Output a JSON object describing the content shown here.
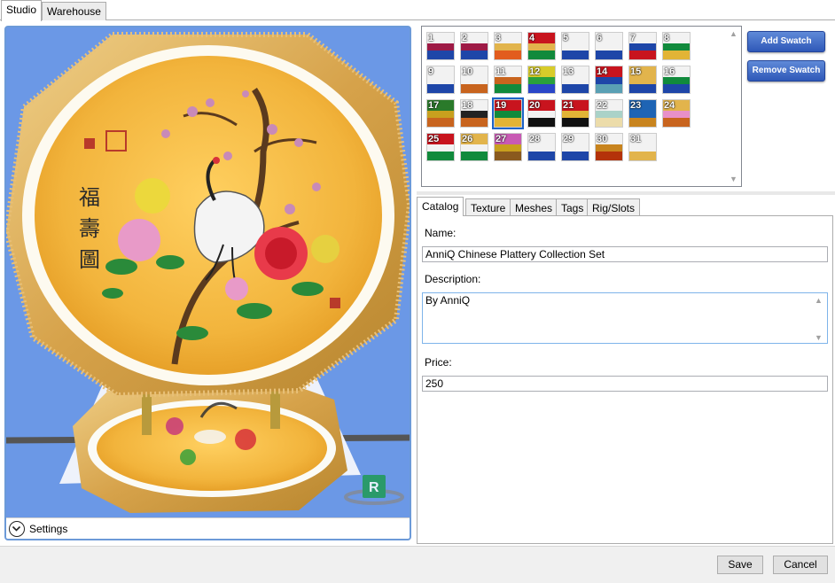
{
  "top_tabs": [
    {
      "label": "Studio",
      "active": true
    },
    {
      "label": "Warehouse",
      "active": false
    }
  ],
  "viewport": {
    "settings_label": "Settings",
    "nav_cube_label": "R"
  },
  "swatches": [
    {
      "n": "1",
      "c": [
        "#f2f2f2",
        "#9e1a46",
        "#1e46a8"
      ]
    },
    {
      "n": "2",
      "c": [
        "#f2f2f2",
        "#9e1a46",
        "#1e46a8"
      ]
    },
    {
      "n": "3",
      "c": [
        "#f2f2f2",
        "#e2b44c",
        "#e25c1e"
      ]
    },
    {
      "n": "4",
      "c": [
        "#c8141e",
        "#e2b44c",
        "#118a3c"
      ]
    },
    {
      "n": "5",
      "c": [
        "#f2f2f2",
        "#f2f2f2",
        "#1e46a8"
      ]
    },
    {
      "n": "6",
      "c": [
        "#f2f2f2",
        "#f2f2f2",
        "#1e46a8"
      ]
    },
    {
      "n": "7",
      "c": [
        "#f2f2f2",
        "#1e46a8",
        "#c8141e"
      ]
    },
    {
      "n": "8",
      "c": [
        "#f2f2f2",
        "#118a3c",
        "#e2b436"
      ]
    },
    {
      "n": "9",
      "c": [
        "#f2f2f2",
        "#f2f2f2",
        "#1e46a8"
      ]
    },
    {
      "n": "10",
      "c": [
        "#f2f2f2",
        "#f2f2f2",
        "#c8641e"
      ]
    },
    {
      "n": "11",
      "c": [
        "#f2f2f2",
        "#c8641e",
        "#118a3c"
      ]
    },
    {
      "n": "12",
      "c": [
        "#d8cc2a",
        "#2aa03c",
        "#2a46c8"
      ]
    },
    {
      "n": "13",
      "c": [
        "#f2f2f2",
        "#f2f2f2",
        "#1e46a8"
      ]
    },
    {
      "n": "14",
      "c": [
        "#c8141e",
        "#1e46a8",
        "#5aa0b4"
      ]
    },
    {
      "n": "15",
      "c": [
        "#e2b44c",
        "#e2b44c",
        "#1e46a8"
      ]
    },
    {
      "n": "16",
      "c": [
        "#f2f2f2",
        "#118a3c",
        "#1e46a8"
      ]
    },
    {
      "n": "17",
      "c": [
        "#2a7a2a",
        "#c8a01e",
        "#c8641e"
      ]
    },
    {
      "n": "18",
      "c": [
        "#f2f2f2",
        "#222222",
        "#c8641e"
      ]
    },
    {
      "n": "19",
      "c": [
        "#c8141e",
        "#118a3c",
        "#e2b436"
      ]
    },
    {
      "n": "20",
      "c": [
        "#c8141e",
        "#f2f2f2",
        "#111111"
      ]
    },
    {
      "n": "21",
      "c": [
        "#c8141e",
        "#e2b436",
        "#111111"
      ]
    },
    {
      "n": "22",
      "c": [
        "#f2f2f2",
        "#aad2c8",
        "#ecdcaa"
      ]
    },
    {
      "n": "23",
      "c": [
        "#1e64b4",
        "#1e64b4",
        "#c8841e"
      ]
    },
    {
      "n": "24",
      "c": [
        "#e2b44c",
        "#e890c8",
        "#c8641e"
      ]
    },
    {
      "n": "25",
      "c": [
        "#c8141e",
        "#f2f2f2",
        "#118a3c"
      ]
    },
    {
      "n": "26",
      "c": [
        "#e2b44c",
        "#f2f2f2",
        "#118a3c"
      ]
    },
    {
      "n": "27",
      "c": [
        "#c85ab4",
        "#c8a01e",
        "#8a5a1e"
      ]
    },
    {
      "n": "28",
      "c": [
        "#f2f2f2",
        "#f2f2f2",
        "#1e46a8"
      ]
    },
    {
      "n": "29",
      "c": [
        "#f2f2f2",
        "#f2f2f2",
        "#1e46a8"
      ]
    },
    {
      "n": "30",
      "c": [
        "#f2f2f2",
        "#c8841e",
        "#b4320a"
      ]
    },
    {
      "n": "31",
      "c": [
        "#f2f2f2",
        "#f2f2f2",
        "#e2b44c"
      ]
    }
  ],
  "selected_swatch": "19",
  "buttons": {
    "add_swatch": "Add Swatch",
    "remove_swatch": "Remove Swatch",
    "save": "Save",
    "cancel": "Cancel"
  },
  "detail_tabs": [
    {
      "label": "Catalog",
      "active": true
    },
    {
      "label": "Texture",
      "active": false
    },
    {
      "label": "Meshes",
      "active": false
    },
    {
      "label": "Tags",
      "active": false
    },
    {
      "label": "Rig/Slots",
      "active": false
    }
  ],
  "catalog": {
    "name_label": "Name:",
    "name_value": "AnniQ Chinese Plattery Collection Set",
    "description_label": "Description:",
    "description_value": "By AnniQ",
    "price_label": "Price:",
    "price_value": "250"
  },
  "colors": {
    "viewport_bg": "#6b98e6",
    "plate_gold": "#f2b43c",
    "plate_rim": "#d8a64a",
    "accent_blue": "#2f58b8"
  },
  "plate_calligraphy": [
    "福",
    "壽",
    "圖"
  ]
}
